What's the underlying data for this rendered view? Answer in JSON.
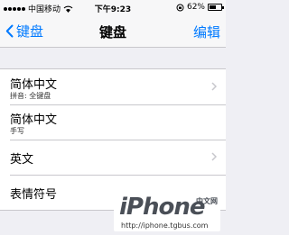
{
  "status_bar": {
    "carrier": "中国移动",
    "time": "下午9:23",
    "battery_text": "62%",
    "battery_level": 0.62
  },
  "nav": {
    "back_label": "键盘",
    "title": "键盘",
    "edit_label": "编辑",
    "accent_color": "#007aff"
  },
  "keyboards": [
    {
      "title": "简体中文",
      "subtitle": "拼音: 全键盘"
    },
    {
      "title": "简体中文",
      "subtitle": "手写"
    },
    {
      "title": "英文"
    },
    {
      "title": "表情符号"
    }
  ],
  "watermark": {
    "brand": "iPhone",
    "chinese": "中文网",
    "url": "http://iphone.tgbus.com"
  }
}
